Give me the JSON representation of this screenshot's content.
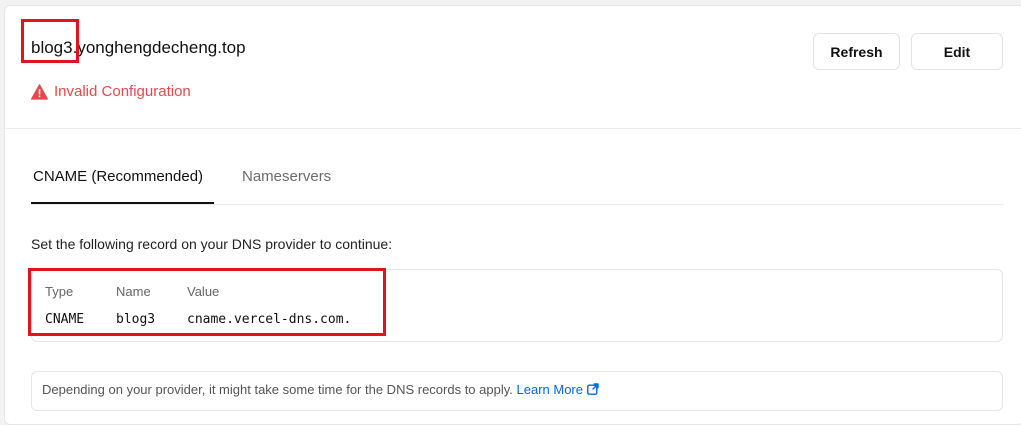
{
  "domain": {
    "name": "blog3.yonghengdecheng.top",
    "status": "Invalid Configuration",
    "status_color": "#e5484d"
  },
  "actions": {
    "refresh_label": "Refresh",
    "edit_label": "Edit"
  },
  "tabs": [
    {
      "label": "CNAME (Recommended)",
      "active": true
    },
    {
      "label": "Nameservers",
      "active": false
    }
  ],
  "instructions": "Set the following record on your DNS provider to continue:",
  "record": {
    "headers": [
      "Type",
      "Name",
      "Value"
    ],
    "values": [
      "CNAME",
      "blog3",
      "cname.vercel-dns.com."
    ]
  },
  "note": {
    "text": "Depending on your provider, it might take some time for the DNS records to apply.",
    "link_label": "Learn More",
    "link_color": "#0068d6"
  },
  "highlight_color": "#e0141e"
}
